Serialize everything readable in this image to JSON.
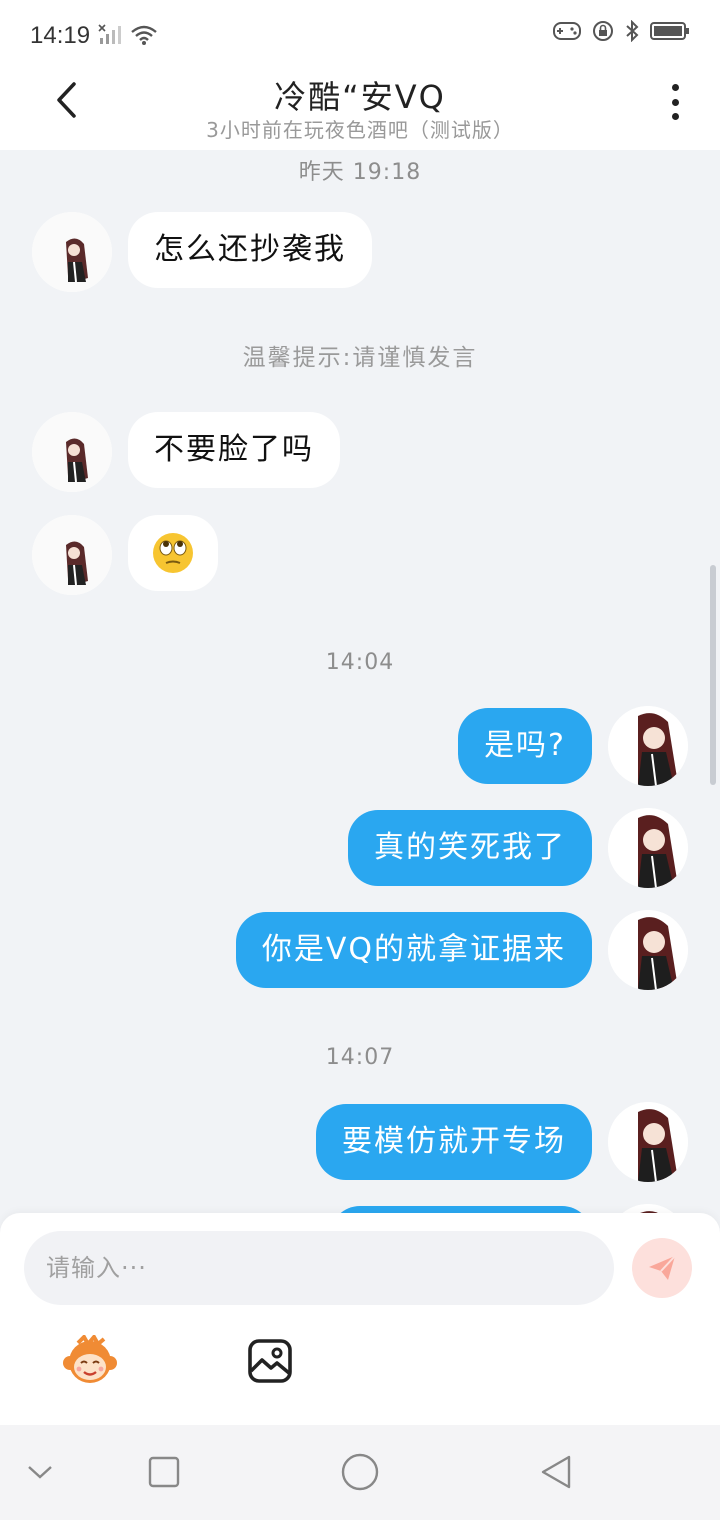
{
  "status_bar": {
    "time": "14:19",
    "icons": [
      "signal-muted-icon",
      "wifi-icon",
      "game-controller-icon",
      "rotation-lock-icon",
      "bluetooth-icon",
      "battery-icon"
    ]
  },
  "header": {
    "title": "冷酷“安VQ",
    "subtitle": "3小时前在玩夜色酒吧（测试版）",
    "back_icon": "back-chevron-icon",
    "more_icon": "more-vertical-icon"
  },
  "chat": {
    "timestamps": [
      "昨天 19:18",
      "14:04",
      "14:07"
    ],
    "notice": "温馨提示:请谨慎发言",
    "messages": [
      {
        "side": "in",
        "text": "怎么还抄袭我"
      },
      {
        "side": "in",
        "text": "不要脸了吗"
      },
      {
        "side": "in",
        "text": "🙄"
      },
      {
        "side": "out",
        "text": "是吗?"
      },
      {
        "side": "out",
        "text": "真的笑死我了"
      },
      {
        "side": "out",
        "text": "你是VQ的就拿证据来"
      },
      {
        "side": "out",
        "text": "要模仿就开专场"
      }
    ]
  },
  "composer": {
    "placeholder": "请输入···",
    "send_icon": "send-icon",
    "tools": [
      "monkey-emoji-icon",
      "image-icon"
    ]
  },
  "colors": {
    "outgoing_bubble": "#2aa7f0",
    "incoming_bubble": "#ffffff",
    "background": "#f1f3f6",
    "send_button": "#fde0dc"
  }
}
